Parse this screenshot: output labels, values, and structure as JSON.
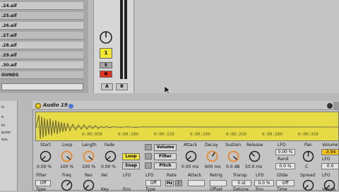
{
  "browser": {
    "files": [
      ".24.aif",
      ".25.aif",
      ".26.aif",
      ".27.aif",
      ".28.aif",
      ".29.aif",
      ".30.aif",
      "OUNDS"
    ]
  },
  "mixer": {
    "track_number": "1",
    "solo_label": "S",
    "a_label": "A",
    "b_label": "B"
  },
  "info_panel": {
    "lines": [
      "is",
      "e",
      "to",
      "puter",
      "eys."
    ]
  },
  "device": {
    "name": "Audio 19",
    "timeline": [
      "0:00:050",
      "0:00:100",
      "0:00:150",
      "0:00:200",
      "0:00:250",
      "0:00:300",
      "0:00:350"
    ],
    "row1_labels": {
      "start": "Start",
      "loop": "Loop",
      "length": "Length",
      "fade": "Fade",
      "attack": "Attack",
      "decay": "Decay",
      "sustain": "Sustain",
      "release": "Release",
      "lfo": "LFO",
      "pan": "Pan",
      "volume": "Volume",
      "rand": "Rand"
    },
    "row1_values": {
      "start": "0.00 %",
      "loop": "100 %",
      "length": "100 %",
      "fade": "0.00 %",
      "attack": "0.00 ms",
      "decay": "600 ms",
      "sustain": "0.0 dB",
      "release": "50.0 ms",
      "lfo": "0.00 %",
      "rand": "0.0 %",
      "pan": "C",
      "volume": "-3.94",
      "volume_lfo": "0.0"
    },
    "row1_buttons": {
      "loop": "Loop",
      "snap": "Snap",
      "volume": "Volume",
      "filter": "Filter",
      "pitch": "Pitch"
    },
    "row2_labels": {
      "filter": "Filter",
      "freq": "Freq",
      "res": "Res",
      "vel": "Vel",
      "lfo": "LFO",
      "lfo2": "LFO",
      "rate": "Rate",
      "attack": "Attack",
      "retrig": "Retrig",
      "transp": "Transp",
      "lfo3": "LFO",
      "glide": "Glide",
      "spread": "Spread",
      "vol_lfo": "LFO"
    },
    "row2_values": {
      "filter": "Off",
      "lfo2": "Off",
      "rate_hz": "Hz",
      "rate_note": "♪",
      "transp": "0 st",
      "lfo3": "0.0 %",
      "glide": "Off"
    },
    "row3_labels": {
      "type": "Type",
      "env": "Env",
      "key": "Key",
      "offset": "Offset",
      "detune": "Detune",
      "env2": "Env",
      "time": "Time",
      "voices": "Voices",
      "type2": "Type"
    }
  }
}
